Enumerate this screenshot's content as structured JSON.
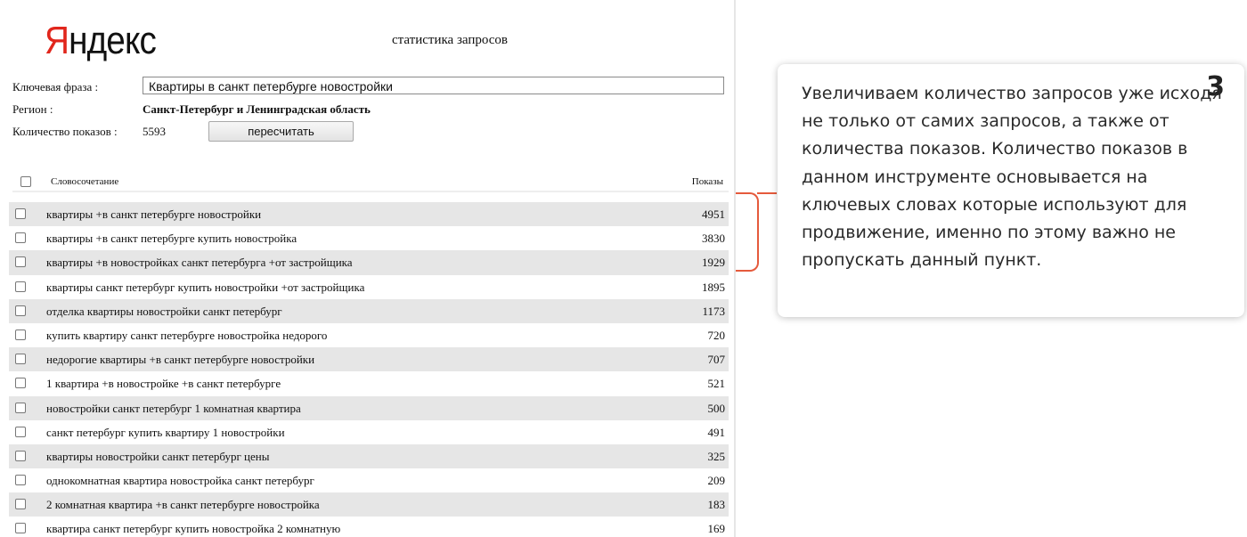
{
  "header": {
    "logo_first": "Я",
    "logo_rest": "ндекс",
    "page_title": "статистика запросов"
  },
  "form": {
    "phrase_label": "Ключевая фраза :",
    "phrase_value": "Квартиры в санкт петербурге новостройки",
    "region_label": "Регион :",
    "region_value": "Санкт-Петербург и Ленинградская область",
    "shows_label": "Количество показов :",
    "shows_value": "5593",
    "recalc_label": "пересчитать"
  },
  "table": {
    "col_phrase": "Словосочетание",
    "col_shows": "Показы",
    "rows": [
      {
        "phrase": "квартиры +в санкт петербурге новостройки",
        "count": "4951"
      },
      {
        "phrase": "квартиры +в санкт петербурге купить новостройка",
        "count": "3830"
      },
      {
        "phrase": "квартиры +в новостройках санкт петербурга +от застройщика",
        "count": "1929"
      },
      {
        "phrase": "квартиры санкт петербург купить новостройки +от застройщика",
        "count": "1895"
      },
      {
        "phrase": "отделка квартиры новостройки санкт петербург",
        "count": "1173"
      },
      {
        "phrase": "купить квартиру санкт петербурге новостройка недорого",
        "count": "720"
      },
      {
        "phrase": "недорогие квартиры +в санкт петербурге новостройки",
        "count": "707"
      },
      {
        "phrase": "1 квартира +в новостройке +в санкт петербурге",
        "count": "521"
      },
      {
        "phrase": "новостройки санкт петербург 1 комнатная квартира",
        "count": "500"
      },
      {
        "phrase": "санкт петербург купить квартиру 1 новостройки",
        "count": "491"
      },
      {
        "phrase": "квартиры новостройки санкт петербург цены",
        "count": "325"
      },
      {
        "phrase": "однокомнатная квартира новостройка санкт петербург",
        "count": "209"
      },
      {
        "phrase": "2 комнатная квартира +в санкт петербурге новостройка",
        "count": "183"
      },
      {
        "phrase": "квартира санкт петербург купить новостройка 2 комнатную",
        "count": "169"
      }
    ]
  },
  "callout": {
    "step_number": "3",
    "text": "Увеличиваем количество запросов уже исходя не только от самих запросов, а также от количества показов. Количество показов в данном инструменте основывается на ключевых словах которые используют для продвижение, именно по этому важно не пропускать данный пункт."
  },
  "colors": {
    "accent": "#e55a3c",
    "logo_red": "#e1261c",
    "row_shade": "#e6e6e6"
  }
}
